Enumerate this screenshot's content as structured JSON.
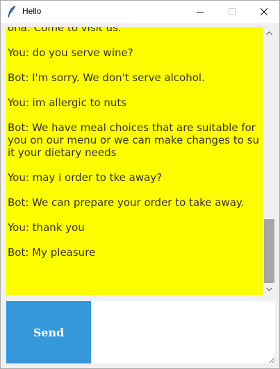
{
  "window": {
    "title": "Hello",
    "app_icon": "feather-icon"
  },
  "chat": {
    "background": "#ffff00",
    "text_color": "#333333",
    "messages": [
      "ona: Come to visit us.",
      "You: do you serve wine?",
      "Bot: I'm sorry. We don't serve alcohol.",
      "You: im allergic to nuts",
      "Bot: We have meal choices that are suitable for you on our menu or we can make changes to suit your dietary needs",
      "You: may i order to tke away?",
      "Bot: We can prepare your order to take away.",
      "You: thank you",
      "Bot: My pleasure"
    ]
  },
  "composer": {
    "send_label": "Send",
    "send_color": "#3498db",
    "input_value": ""
  }
}
